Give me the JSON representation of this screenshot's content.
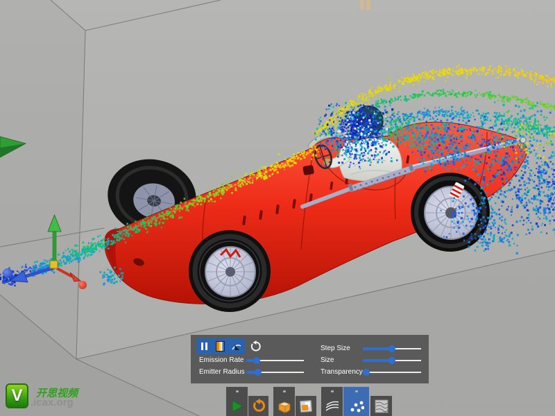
{
  "viewport": {
    "top_handle": "collapsed-panel-handle"
  },
  "panel": {
    "buttons": [
      {
        "name": "pause"
      },
      {
        "name": "colormap"
      },
      {
        "name": "probe"
      },
      {
        "name": "reset"
      }
    ],
    "sliders": [
      {
        "label": "Emission Rate",
        "value_pct": 18
      },
      {
        "label": "Emitter Radius",
        "value_pct": 20
      },
      {
        "label": "Step Size",
        "value_pct": 50
      },
      {
        "label": "Size",
        "value_pct": 50
      },
      {
        "label": "Transparency",
        "value_pct": 6
      }
    ]
  },
  "toolbar": {
    "tools": [
      {
        "name": "play",
        "icon": "play-icon",
        "tab": true,
        "selected": false
      },
      {
        "name": "reset",
        "icon": "reset-icon",
        "tab": false,
        "selected": false
      },
      {
        "name": "solid",
        "icon": "solid-box-icon",
        "tab": true,
        "selected": false
      },
      {
        "name": "clipboard",
        "icon": "clipboard-icon",
        "tab": false,
        "selected": false
      },
      {
        "name": "streamlines",
        "icon": "streamlines-icon",
        "tab": true,
        "selected": false
      },
      {
        "name": "particles",
        "icon": "particles-icon",
        "tab": true,
        "selected": true
      },
      {
        "name": "texture",
        "icon": "texture-icon",
        "tab": false,
        "selected": false
      }
    ]
  },
  "watermark": {
    "logo_letter": "V",
    "brand": "开思视频",
    "site": ".icax.org"
  },
  "colors": {
    "accent_blue": "#2e6fd4",
    "panel_bg": "#565656",
    "toolbar_selected": "#3c6db4",
    "car_red": "#ee2c1a",
    "background": "#b2b2b0"
  }
}
